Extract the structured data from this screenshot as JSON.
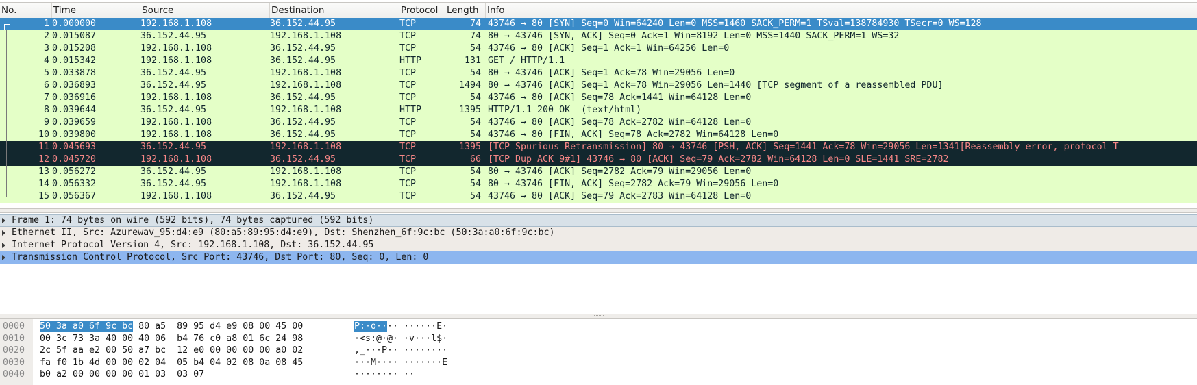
{
  "packet_list": {
    "columns": [
      "No.",
      "Time",
      "Source",
      "Destination",
      "Protocol",
      "Length",
      "Info"
    ],
    "rows": [
      {
        "no": "1",
        "time": "0.000000",
        "src": "192.168.1.108",
        "dst": "36.152.44.95",
        "proto": "TCP",
        "len": "74",
        "info": "43746 → 80 [SYN] Seq=0 Win=64240 Len=0 MSS=1460 SACK_PERM=1 TSval=138784930 TSecr=0 WS=128",
        "state": "selected"
      },
      {
        "no": "2",
        "time": "0.015087",
        "src": "36.152.44.95",
        "dst": "192.168.1.108",
        "proto": "TCP",
        "len": "74",
        "info": "80 → 43746 [SYN, ACK] Seq=0 Ack=1 Win=8192 Len=0 MSS=1440 SACK_PERM=1 WS=32",
        "state": "normal"
      },
      {
        "no": "3",
        "time": "0.015208",
        "src": "192.168.1.108",
        "dst": "36.152.44.95",
        "proto": "TCP",
        "len": "54",
        "info": "43746 → 80 [ACK] Seq=1 Ack=1 Win=64256 Len=0",
        "state": "normal"
      },
      {
        "no": "4",
        "time": "0.015342",
        "src": "192.168.1.108",
        "dst": "36.152.44.95",
        "proto": "HTTP",
        "len": "131",
        "info": "GET / HTTP/1.1",
        "state": "normal"
      },
      {
        "no": "5",
        "time": "0.033878",
        "src": "36.152.44.95",
        "dst": "192.168.1.108",
        "proto": "TCP",
        "len": "54",
        "info": "80 → 43746 [ACK] Seq=1 Ack=78 Win=29056 Len=0",
        "state": "normal"
      },
      {
        "no": "6",
        "time": "0.036893",
        "src": "36.152.44.95",
        "dst": "192.168.1.108",
        "proto": "TCP",
        "len": "1494",
        "info": "80 → 43746 [ACK] Seq=1 Ack=78 Win=29056 Len=1440 [TCP segment of a reassembled PDU]",
        "state": "normal"
      },
      {
        "no": "7",
        "time": "0.036916",
        "src": "192.168.1.108",
        "dst": "36.152.44.95",
        "proto": "TCP",
        "len": "54",
        "info": "43746 → 80 [ACK] Seq=78 Ack=1441 Win=64128 Len=0",
        "state": "normal"
      },
      {
        "no": "8",
        "time": "0.039644",
        "src": "36.152.44.95",
        "dst": "192.168.1.108",
        "proto": "HTTP",
        "len": "1395",
        "info": "HTTP/1.1 200 OK  (text/html)",
        "state": "normal"
      },
      {
        "no": "9",
        "time": "0.039659",
        "src": "192.168.1.108",
        "dst": "36.152.44.95",
        "proto": "TCP",
        "len": "54",
        "info": "43746 → 80 [ACK] Seq=78 Ack=2782 Win=64128 Len=0",
        "state": "normal"
      },
      {
        "no": "10",
        "time": "0.039800",
        "src": "192.168.1.108",
        "dst": "36.152.44.95",
        "proto": "TCP",
        "len": "54",
        "info": "43746 → 80 [FIN, ACK] Seq=78 Ack=2782 Win=64128 Len=0",
        "state": "normal"
      },
      {
        "no": "11",
        "time": "0.045693",
        "src": "36.152.44.95",
        "dst": "192.168.1.108",
        "proto": "TCP",
        "len": "1395",
        "info": "[TCP Spurious Retransmission] 80 → 43746 [PSH, ACK] Seq=1441 Ack=78 Win=29056 Len=1341[Reassembly error, protocol T",
        "state": "bad"
      },
      {
        "no": "12",
        "time": "0.045720",
        "src": "192.168.1.108",
        "dst": "36.152.44.95",
        "proto": "TCP",
        "len": "66",
        "info": "[TCP Dup ACK 9#1] 43746 → 80 [ACK] Seq=79 Ack=2782 Win=64128 Len=0 SLE=1441 SRE=2782",
        "state": "bad"
      },
      {
        "no": "13",
        "time": "0.056272",
        "src": "36.152.44.95",
        "dst": "192.168.1.108",
        "proto": "TCP",
        "len": "54",
        "info": "80 → 43746 [ACK] Seq=2782 Ack=79 Win=29056 Len=0",
        "state": "normal"
      },
      {
        "no": "14",
        "time": "0.056332",
        "src": "36.152.44.95",
        "dst": "192.168.1.108",
        "proto": "TCP",
        "len": "54",
        "info": "80 → 43746 [FIN, ACK] Seq=2782 Ack=79 Win=29056 Len=0",
        "state": "normal"
      },
      {
        "no": "15",
        "time": "0.056367",
        "src": "192.168.1.108",
        "dst": "36.152.44.95",
        "proto": "TCP",
        "len": "54",
        "info": "43746 → 80 [ACK] Seq=79 Ack=2783 Win=64128 Len=0",
        "state": "normal"
      }
    ]
  },
  "details": [
    {
      "text": "Frame 1: 74 bytes on wire (592 bits), 74 bytes captured (592 bits)",
      "state": "first"
    },
    {
      "text": "Ethernet II, Src: Azurewav_95:d4:e9 (80:a5:89:95:d4:e9), Dst: Shenzhen_6f:9c:bc (50:3a:a0:6f:9c:bc)",
      "state": "normal"
    },
    {
      "text": "Internet Protocol Version 4, Src: 192.168.1.108, Dst: 36.152.44.95",
      "state": "normal"
    },
    {
      "text": "Transmission Control Protocol, Src Port: 43746, Dst Port: 80, Seq: 0, Len: 0",
      "state": "hl"
    }
  ],
  "bytes": [
    {
      "offset": "0000",
      "hex_hl": "50 3a a0 6f 9c bc",
      "hex": " 80 a5  89 95 d4 e9 08 00 45 00",
      "ascii_hl": "P:·o··",
      "ascii": "·· ······E·"
    },
    {
      "offset": "0010",
      "hex_hl": "",
      "hex": "00 3c 73 3a 40 00 40 06  b4 76 c0 a8 01 6c 24 98",
      "ascii_hl": "",
      "ascii": "·<s:@·@· ·v···l$·"
    },
    {
      "offset": "0020",
      "hex_hl": "",
      "hex": "2c 5f aa e2 00 50 a7 bc  12 e0 00 00 00 00 a0 02",
      "ascii_hl": "",
      "ascii": ",_···P·· ········"
    },
    {
      "offset": "0030",
      "hex_hl": "",
      "hex": "fa f0 1b 4d 00 00 02 04  05 b4 04 02 08 0a 08 45",
      "ascii_hl": "",
      "ascii": "···M···· ·······E"
    },
    {
      "offset": "0040",
      "hex_hl": "",
      "hex": "b0 a2 00 00 00 00 01 03  03 07",
      "ascii_hl": "",
      "ascii": "········ ··"
    }
  ],
  "colors": {
    "row_normal_bg": "#e4ffc7",
    "row_selected_bg": "#3a8bc8",
    "row_bad_bg": "#12272e",
    "row_bad_fg": "#f78787",
    "detail_highlight_bg": "#8db6ef"
  }
}
